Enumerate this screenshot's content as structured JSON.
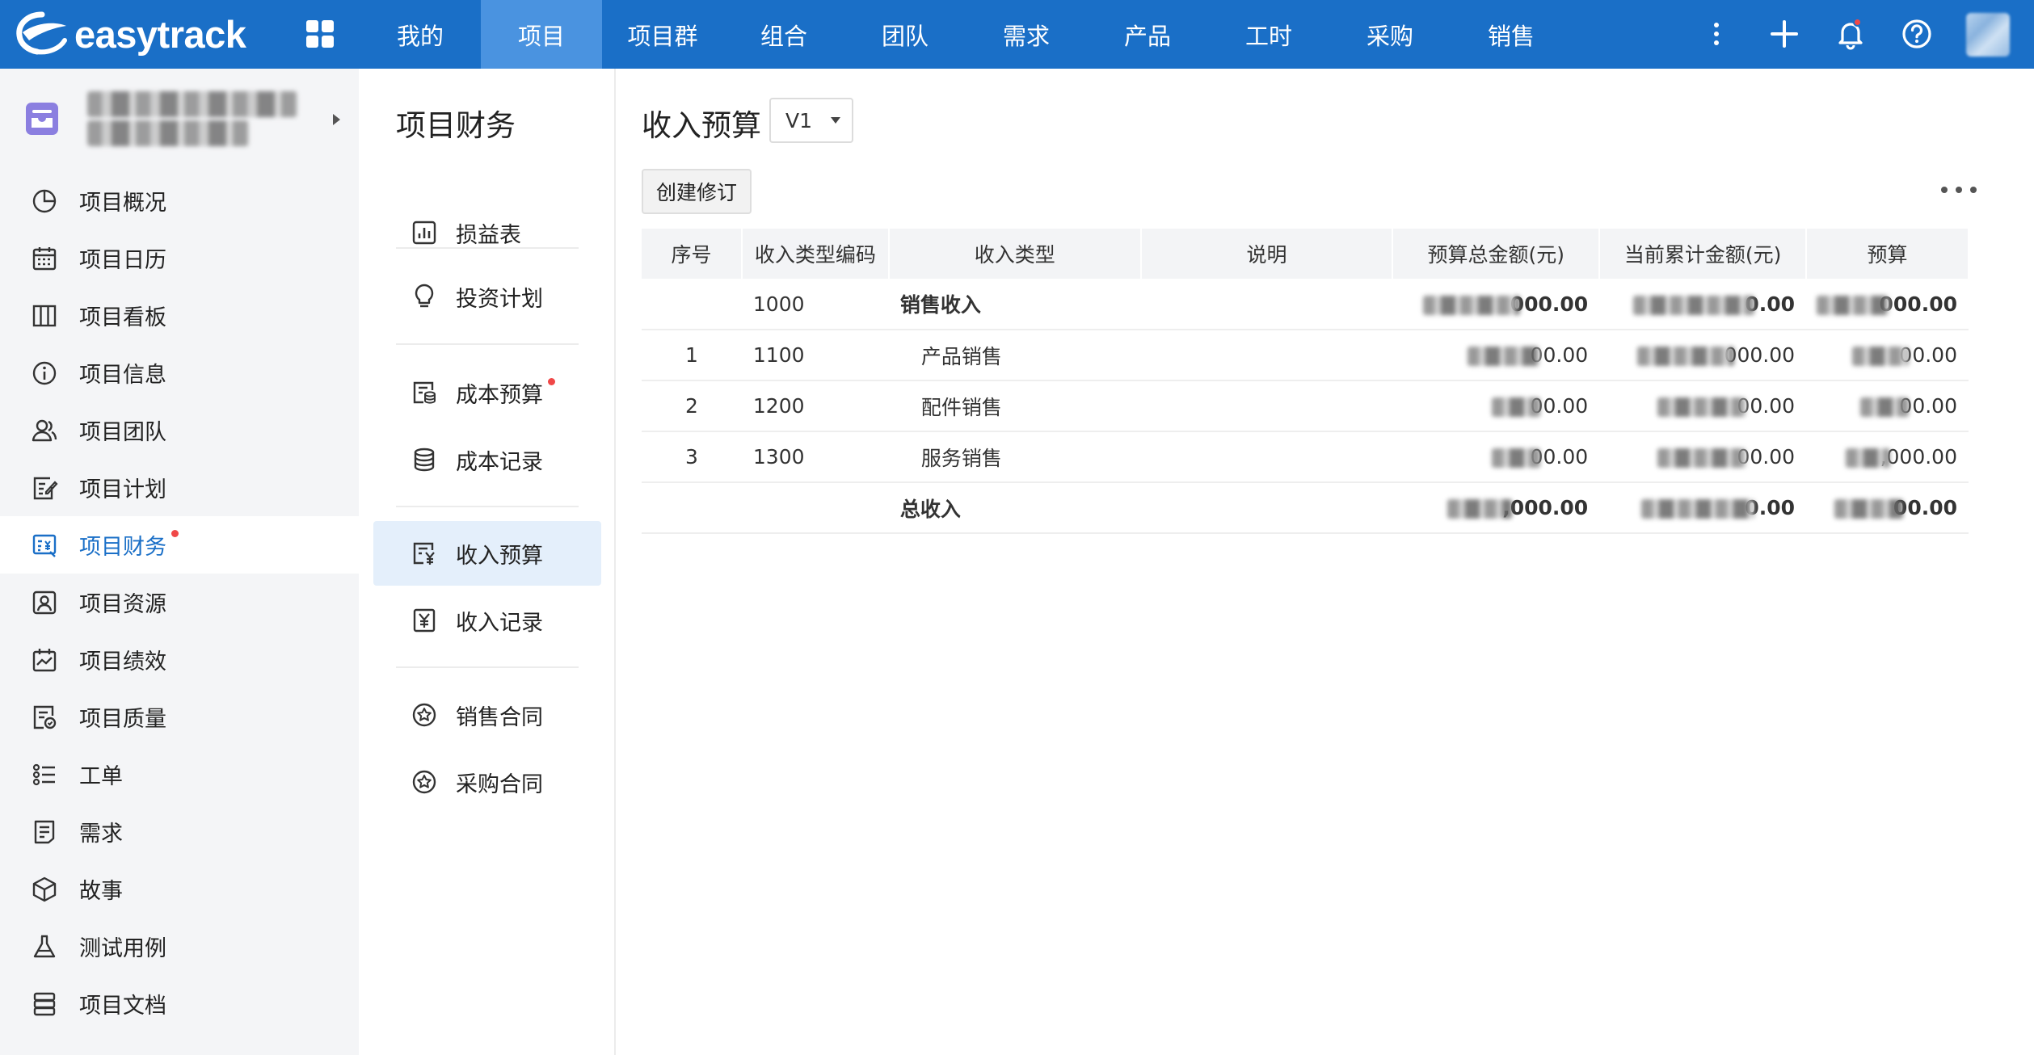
{
  "topbar": {
    "logo_text": "easytrack",
    "nav": [
      {
        "label": "我的",
        "active": false
      },
      {
        "label": "项目",
        "active": true
      },
      {
        "label": "项目群",
        "active": false
      },
      {
        "label": "组合",
        "active": false
      },
      {
        "label": "团队",
        "active": false
      },
      {
        "label": "需求",
        "active": false
      },
      {
        "label": "产品",
        "active": false
      },
      {
        "label": "工时",
        "active": false
      },
      {
        "label": "采购",
        "active": false
      },
      {
        "label": "销售",
        "active": false
      }
    ],
    "icons": [
      "more-vertical-icon",
      "plus-icon",
      "bell-icon",
      "help-icon"
    ],
    "accent_color": "#1a6fc7",
    "notification_dot_color": "#f04848"
  },
  "sidebar": {
    "items": [
      {
        "label": "项目概况",
        "icon": "pie-chart-icon",
        "active": false,
        "dot": false
      },
      {
        "label": "项目日历",
        "icon": "calendar-icon",
        "active": false,
        "dot": false
      },
      {
        "label": "项目看板",
        "icon": "kanban-icon",
        "active": false,
        "dot": false
      },
      {
        "label": "项目信息",
        "icon": "info-icon",
        "active": false,
        "dot": false
      },
      {
        "label": "项目团队",
        "icon": "team-icon",
        "active": false,
        "dot": false
      },
      {
        "label": "项目计划",
        "icon": "plan-icon",
        "active": false,
        "dot": false
      },
      {
        "label": "项目财务",
        "icon": "finance-icon",
        "active": true,
        "dot": true
      },
      {
        "label": "项目资源",
        "icon": "resource-icon",
        "active": false,
        "dot": false
      },
      {
        "label": "项目绩效",
        "icon": "performance-icon",
        "active": false,
        "dot": false
      },
      {
        "label": "项目质量",
        "icon": "quality-icon",
        "active": false,
        "dot": false
      },
      {
        "label": "工单",
        "icon": "ticket-list-icon",
        "active": false,
        "dot": false
      },
      {
        "label": "需求",
        "icon": "requirement-icon",
        "active": false,
        "dot": false
      },
      {
        "label": "故事",
        "icon": "story-cube-icon",
        "active": false,
        "dot": false
      },
      {
        "label": "测试用例",
        "icon": "flask-icon",
        "active": false,
        "dot": false
      },
      {
        "label": "项目文档",
        "icon": "document-icon",
        "active": false,
        "dot": false
      }
    ]
  },
  "subnav": {
    "title": "项目财务",
    "items": [
      {
        "label": "损益表",
        "icon": "income-statement-icon",
        "active": false,
        "dot": false
      },
      {
        "label": "投资计划",
        "icon": "lightbulb-icon",
        "active": false,
        "dot": false
      },
      {
        "label": "成本预算",
        "icon": "cost-budget-icon",
        "active": false,
        "dot": true
      },
      {
        "label": "成本记录",
        "icon": "database-icon",
        "active": false,
        "dot": false
      },
      {
        "label": "收入预算",
        "icon": "income-budget-icon",
        "active": true,
        "dot": false
      },
      {
        "label": "收入记录",
        "icon": "income-record-icon",
        "active": false,
        "dot": false
      },
      {
        "label": "销售合同",
        "icon": "star-circle-icon",
        "active": false,
        "dot": false
      },
      {
        "label": "采购合同",
        "icon": "star-circle-icon",
        "active": false,
        "dot": false
      }
    ]
  },
  "main": {
    "title": "收入预算",
    "version": "V1",
    "create_revision_label": "创建修订",
    "table": {
      "headers": [
        "序号",
        "收入类型编码",
        "收入类型",
        "说明",
        "预算总金额(元)",
        "当前累计金额(元)",
        "预算"
      ],
      "rows": [
        {
          "seq": "",
          "code": "1000",
          "type": "销售收入",
          "desc": "",
          "amount": "000.00",
          "current": "0.00",
          "budget": "000.00",
          "bold": true,
          "indent": false
        },
        {
          "seq": "1",
          "code": "1100",
          "type": "产品销售",
          "desc": "",
          "amount": "00.00",
          "current": "000.00",
          "budget": "00.00",
          "bold": false,
          "indent": true
        },
        {
          "seq": "2",
          "code": "1200",
          "type": "配件销售",
          "desc": "",
          "amount": "00.00",
          "current": "00.00",
          "budget": "00.00",
          "bold": false,
          "indent": true
        },
        {
          "seq": "3",
          "code": "1300",
          "type": "服务销售",
          "desc": "",
          "amount": "00.00",
          "current": "00.00",
          "budget": ",000.00",
          "bold": false,
          "indent": true
        },
        {
          "seq": "",
          "code": "",
          "type": "总收入",
          "desc": "",
          "amount": ",000.00",
          "current": "0.00",
          "budget": "00.00",
          "bold": true,
          "indent": false
        }
      ]
    }
  }
}
